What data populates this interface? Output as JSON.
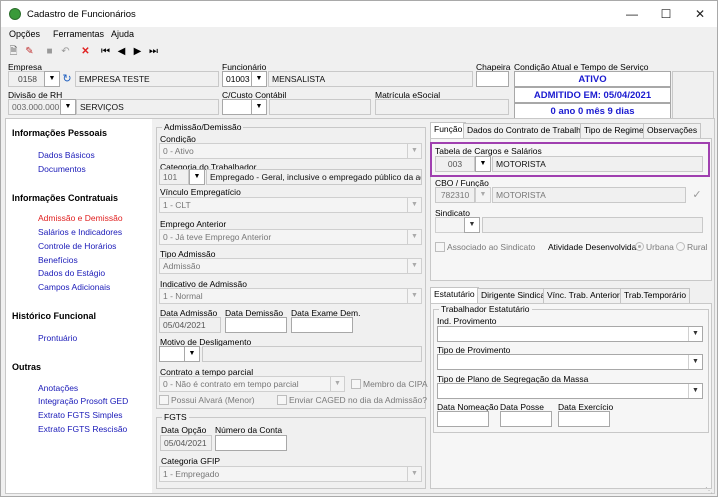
{
  "window": {
    "title": "Cadastro de Funcionários"
  },
  "menu": [
    "Opções",
    "Ferramentas",
    "Ajuda"
  ],
  "header": {
    "empresa_label": "Empresa",
    "empresa_code": "0158",
    "empresa_name": "EMPRESA TESTE",
    "funcionario_label": "Funcionário",
    "funcionario_code": "01003",
    "funcionario_name": "MENSALISTA",
    "chapeira_label": "Chapeira",
    "condicao_label": "Condição Atual e Tempo de Serviço",
    "status_ativo": "ATIVO",
    "status_admitido": "ADMITIDO EM: 05/04/2021",
    "status_tempo": "0 ano 0 mês 9 dias",
    "divisao_label": "Divisão de RH",
    "divisao_code": "003.000.000",
    "divisao_name": "SERVIÇOS",
    "ccusto_label": "C/Custo Contábil",
    "matricula_label": "Matrícula eSocial"
  },
  "nav": {
    "h1": "Informações Pessoais",
    "dados_basicos": "Dados Básicos",
    "documentos": "Documentos",
    "h2": "Informações Contratuais",
    "admissao": "Admissão e Demissão",
    "salarios": "Salários e Indicadores",
    "horarios": "Controle de Horários",
    "beneficios": "Benefícios",
    "estagio": "Dados do Estágio",
    "campos": "Campos Adicionais",
    "h3": "Histórico Funcional",
    "prontuario": "Prontuário",
    "h4": "Outras",
    "anotacoes": "Anotações",
    "prosoft": "Integração Prosoft GED",
    "fgts_simples": "Extrato FGTS Simples",
    "fgts_rescisao": "Extrato FGTS Rescisão"
  },
  "admissao": {
    "group": "Admissão/Demissão",
    "condicao_label": "Condição",
    "condicao_value": "0 - Ativo",
    "categoria_label": "Categoria do Trabalhador",
    "categoria_code": "101",
    "categoria_desc": "Empregado - Geral, inclusive o empregado público da administ",
    "vinculo_label": "Vínculo Empregatício",
    "vinculo_value": "1 - CLT",
    "emprego_label": "Emprego Anterior",
    "emprego_value": "0 - Já teve Emprego Anterior",
    "tipo_label": "Tipo Admissão",
    "tipo_value": "Admissão",
    "indicativo_label": "Indicativo de Admissão",
    "indicativo_value": "1 - Normal",
    "data_adm_label": "Data Admissão",
    "data_adm_value": "05/04/2021",
    "data_dem_label": "Data Demissão",
    "data_exame_label": "Data Exame Dem.",
    "motivo_label": "Motivo de Desligamento",
    "contrato_label": "Contrato a tempo parcial",
    "contrato_value": "0 - Não é contrato em tempo parcial",
    "membro_cipa": "Membro da CIPA",
    "alvara": "Possui Alvará (Menor)",
    "caged": "Enviar CAGED no dia da Admissão?"
  },
  "fgts": {
    "group": "FGTS",
    "data_opcao_label": "Data Opção",
    "data_opcao_value": "05/04/2021",
    "conta_label": "Número da Conta",
    "gfip_label": "Categoria GFIP",
    "gfip_value": "1 - Empregado"
  },
  "tabs_top": [
    "Função",
    "Dados do Contrato de Trabalho",
    "Tipo de Regime",
    "Observações"
  ],
  "funcao": {
    "tabela_label": "Tabela de Cargos e Salários",
    "tabela_code": "003",
    "tabela_name": "MOTORISTA",
    "cbo_label": "CBO / Função",
    "cbo_code": "782310",
    "cbo_name": "MOTORISTA",
    "sindicato_label": "Sindicato",
    "associado": "Associado ao Sindicato",
    "atividade_label": "Atividade Desenvolvida:",
    "urbana": "Urbana",
    "rural": "Rural"
  },
  "tabs_bottom": [
    "Estatutário",
    "Dirigente Sindical",
    "Vínc. Trab. Anterior",
    "Trab.Temporário"
  ],
  "estatutario": {
    "group": "Trabalhador Estatutário",
    "ind_label": "Ind. Provimento",
    "tipo_prov_label": "Tipo de Provimento",
    "plano_label": "Tipo de Plano de Segregação da Massa",
    "nomeacao_label": "Data Nomeação",
    "posse_label": "Data Posse",
    "exercicio_label": "Data Exercício"
  },
  "colors": {
    "accent_blue": "#1a1ad0",
    "nav_link": "#1a1ab8",
    "nav_active": "#e02020",
    "highlight": "#a040b0"
  }
}
